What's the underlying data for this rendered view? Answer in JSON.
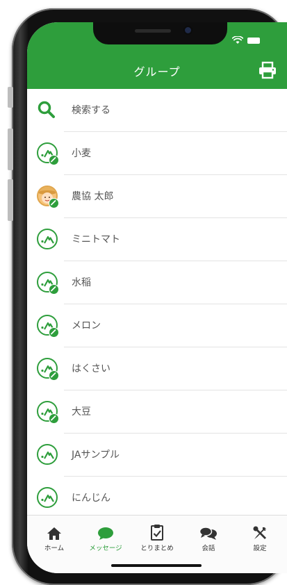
{
  "header": {
    "title": "グループ",
    "accent_color": "#2e9e3c",
    "print_icon": "printer-icon"
  },
  "search": {
    "label": "検索する",
    "icon": "search-icon"
  },
  "groups": [
    {
      "label": "小麦",
      "icon": "ja-logo-icon",
      "checked": true
    },
    {
      "label": "農協 太郎",
      "icon": "farmer-avatar",
      "checked": true
    },
    {
      "label": "ミニトマト",
      "icon": "ja-logo-icon",
      "checked": false
    },
    {
      "label": "水稲",
      "icon": "ja-logo-icon",
      "checked": true
    },
    {
      "label": "メロン",
      "icon": "ja-logo-icon",
      "checked": true
    },
    {
      "label": "はくさい",
      "icon": "ja-logo-icon",
      "checked": true
    },
    {
      "label": "大豆",
      "icon": "ja-logo-icon",
      "checked": true
    },
    {
      "label": "JAサンプル",
      "icon": "ja-logo-icon",
      "checked": false
    },
    {
      "label": "にんじん",
      "icon": "ja-logo-icon",
      "checked": false
    }
  ],
  "tabs": [
    {
      "label": "ホーム",
      "icon": "home-icon",
      "active": false
    },
    {
      "label": "メッセージ",
      "icon": "chat-bubble-icon",
      "active": true
    },
    {
      "label": "とりまとめ",
      "icon": "clipboard-check-icon",
      "active": false
    },
    {
      "label": "会話",
      "icon": "conversation-icon",
      "active": false
    },
    {
      "label": "設定",
      "icon": "tools-icon",
      "active": false
    }
  ]
}
